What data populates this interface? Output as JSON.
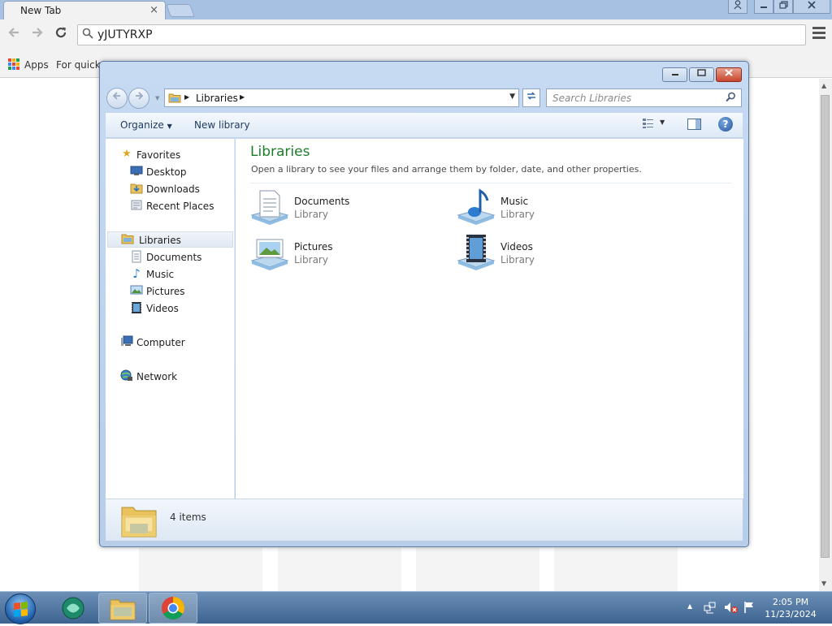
{
  "browser": {
    "tab_title": "New Tab",
    "tab_close": "×",
    "omnibox_value": "yJUTYRXP",
    "bookmarks": {
      "apps_label": "Apps",
      "quick_label": "For quick"
    },
    "icons": [
      "back-arrow-icon",
      "forward-arrow-icon",
      "reload-icon",
      "search-icon",
      "menu-icon",
      "apps-grid-icon"
    ],
    "apps_colors": [
      "#e0463b",
      "#f6b400",
      "#1f9d55",
      "#4285f4",
      "#e0463b",
      "#f6b400",
      "#1f9d55",
      "#4285f4",
      "#e0463b"
    ]
  },
  "explorer": {
    "breadcrumb": "Libraries",
    "search_placeholder": "Search Libraries",
    "commands": {
      "organize": "Organize",
      "new_library": "New library"
    },
    "nav": {
      "favorites": "Favorites",
      "desktop": "Desktop",
      "downloads": "Downloads",
      "recent_places": "Recent Places",
      "libraries": "Libraries",
      "documents": "Documents",
      "music": "Music",
      "pictures": "Pictures",
      "videos": "Videos",
      "computer": "Computer",
      "network": "Network"
    },
    "content": {
      "title": "Libraries",
      "subtitle": "Open a library to see your files and arrange them by folder, date, and other properties.",
      "items": [
        {
          "name": "Documents",
          "kind": "Library",
          "icon": "documents-library-icon"
        },
        {
          "name": "Music",
          "kind": "Library",
          "icon": "music-library-icon"
        },
        {
          "name": "Pictures",
          "kind": "Library",
          "icon": "pictures-library-icon"
        },
        {
          "name": "Videos",
          "kind": "Library",
          "icon": "videos-library-icon"
        }
      ]
    },
    "details": {
      "count": "4 items"
    },
    "accent_title_color": "#1e7d28"
  },
  "taskbar": {
    "time": "2:05 PM",
    "date": "11/23/2024",
    "pinned": [
      "start-orb-icon",
      "app-orb-icon",
      "explorer-folder-icon",
      "chrome-icon"
    ],
    "tray_icons": [
      "show-hidden-icons-icon",
      "network-icon",
      "volume-muted-icon",
      "action-center-flag-icon"
    ]
  }
}
